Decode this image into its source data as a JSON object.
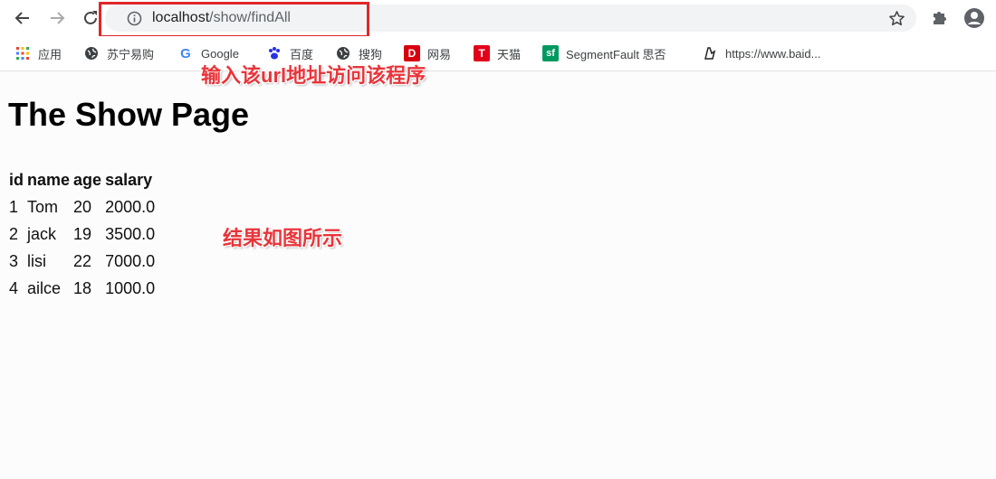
{
  "browser": {
    "url_host": "localhost",
    "url_path": "/show/findAll",
    "bookmarks": [
      {
        "label": "应用",
        "icon": "apps-grid-icon"
      },
      {
        "label": "苏宁易购",
        "icon": "globe-icon"
      },
      {
        "label": "Google",
        "icon": "google-icon"
      },
      {
        "label": "百度",
        "icon": "baidu-paw-icon"
      },
      {
        "label": "搜狗",
        "icon": "globe-icon"
      },
      {
        "label": "网易",
        "icon": "netease-icon"
      },
      {
        "label": "天猫",
        "icon": "tmall-icon"
      },
      {
        "label": "SegmentFault 思否",
        "icon": "segmentfault-icon"
      },
      {
        "label": "https://www.baid...",
        "icon": "bookmark-page-icon"
      }
    ]
  },
  "annotations": {
    "url_note": "输入该url地址访问该程序",
    "result_note": "结果如图所示"
  },
  "colors": {
    "annotation_red": "#e0262b",
    "page_background": "#fdfcfd"
  },
  "page": {
    "title": "The Show Page",
    "table": {
      "headers": [
        "id",
        "name",
        "age",
        "salary"
      ],
      "rows": [
        [
          "1",
          "Tom",
          "20",
          "2000.0"
        ],
        [
          "2",
          "jack",
          "19",
          "3500.0"
        ],
        [
          "3",
          "lisi",
          "22",
          "7000.0"
        ],
        [
          "4",
          "ailce",
          "18",
          "1000.0"
        ]
      ]
    }
  }
}
